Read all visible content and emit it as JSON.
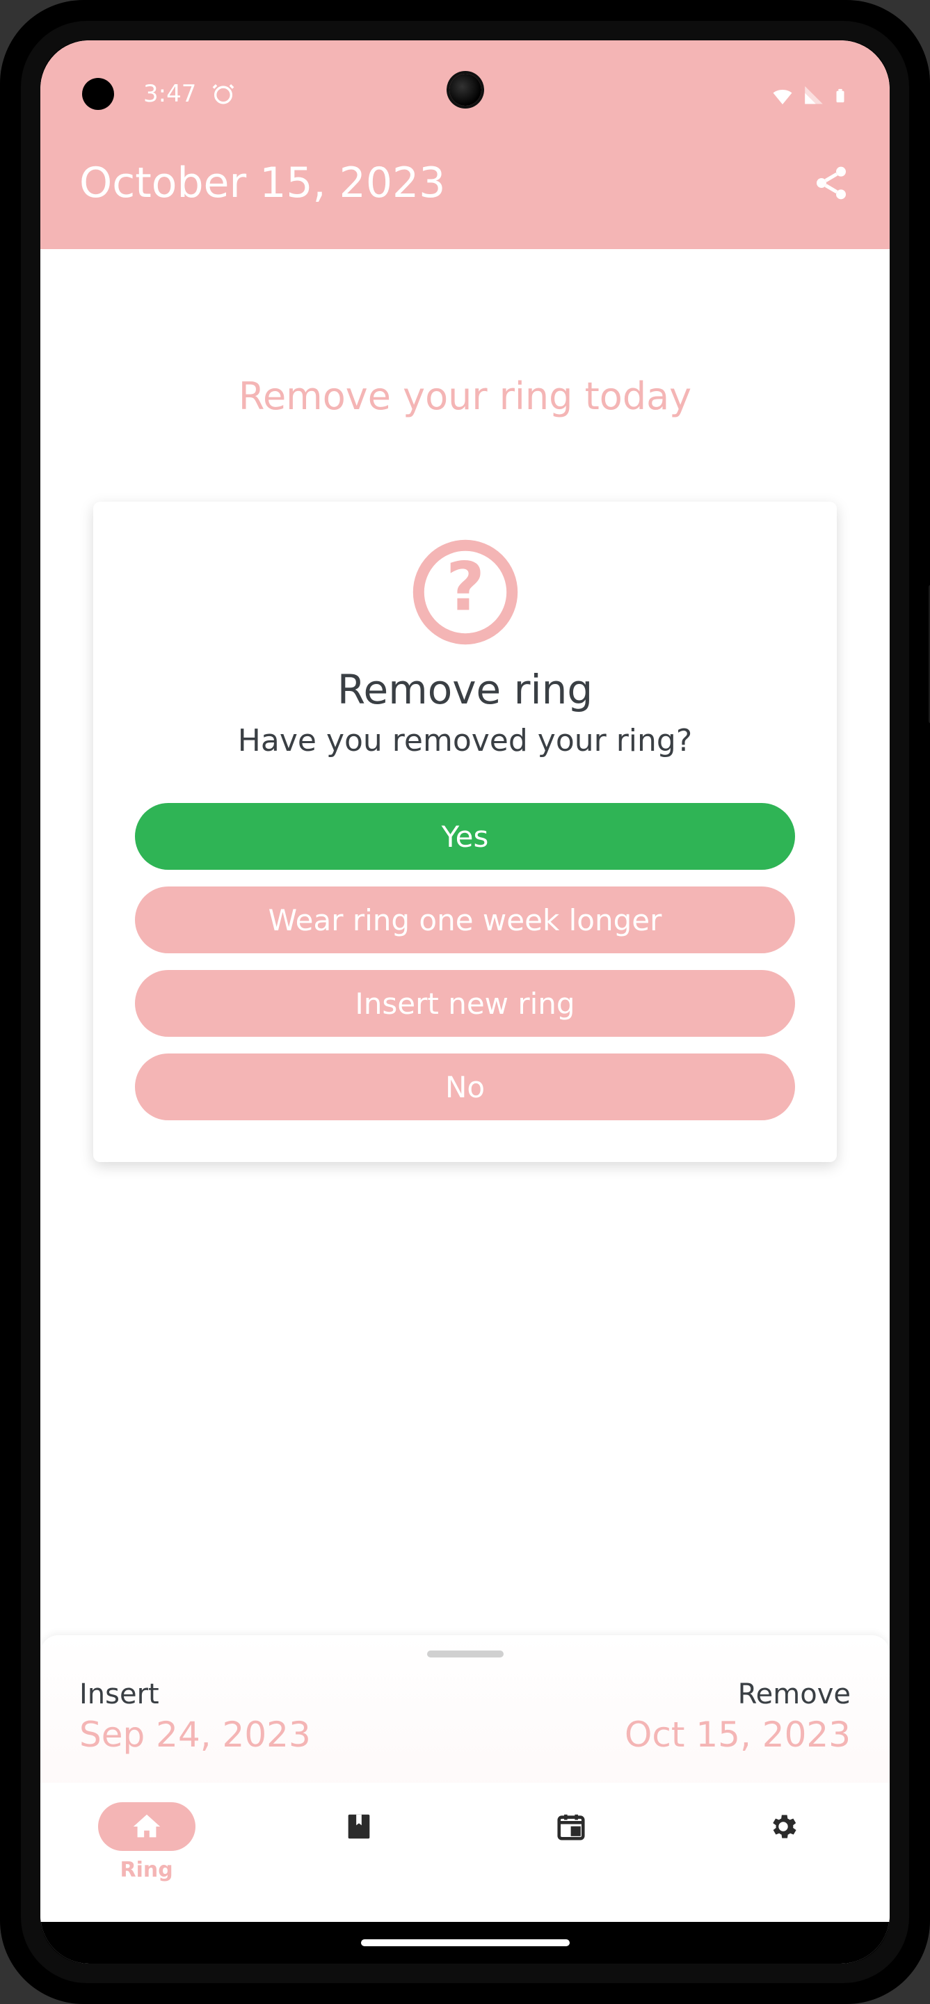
{
  "status": {
    "time": "3:47"
  },
  "header": {
    "title": "October 15, 2023"
  },
  "reminder": {
    "text": "Remove your ring today"
  },
  "card": {
    "title": "Remove ring",
    "question": "Have you removed your ring?",
    "buttons": {
      "yes": "Yes",
      "extend": "Wear ring one week longer",
      "insertNew": "Insert new ring",
      "no": "No"
    }
  },
  "panel": {
    "insert": {
      "label": "Insert",
      "date": "Sep 24, 2023"
    },
    "remove": {
      "label": "Remove",
      "date": "Oct 15, 2023"
    }
  },
  "nav": {
    "ring": "Ring"
  },
  "colors": {
    "accent": "#f4b5b5",
    "primaryButton": "#2fb455",
    "textDark": "#3a3f44"
  }
}
